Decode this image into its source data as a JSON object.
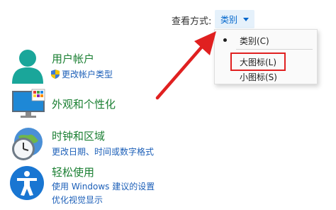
{
  "view_by": {
    "label": "查看方式:",
    "current": "类别"
  },
  "view_menu": {
    "items": [
      {
        "label": "类别(C)",
        "selected": true
      },
      {
        "label": "大图标(L)",
        "selected": false,
        "highlighted": true
      },
      {
        "label": "小图标(S)",
        "selected": false
      }
    ]
  },
  "categories": [
    {
      "title": "用户帐户",
      "links": [
        "更改帐户类型"
      ],
      "icon": "user-accounts-icon"
    },
    {
      "title": "外观和个性化",
      "links": [],
      "icon": "appearance-personalization-icon"
    },
    {
      "title": "时钟和区域",
      "links": [
        "更改日期、时间或数字格式"
      ],
      "icon": "clock-region-icon"
    },
    {
      "title": "轻松使用",
      "links": [
        "使用 Windows 建议的设置",
        "优化视觉显示"
      ],
      "icon": "ease-of-access-icon"
    }
  ],
  "colors": {
    "category_title": "#1a7f32",
    "link": "#1c5fb8",
    "dropdown_bg": "#e5f1fb",
    "highlight_box": "#e02020",
    "arrow": "#e02020"
  }
}
